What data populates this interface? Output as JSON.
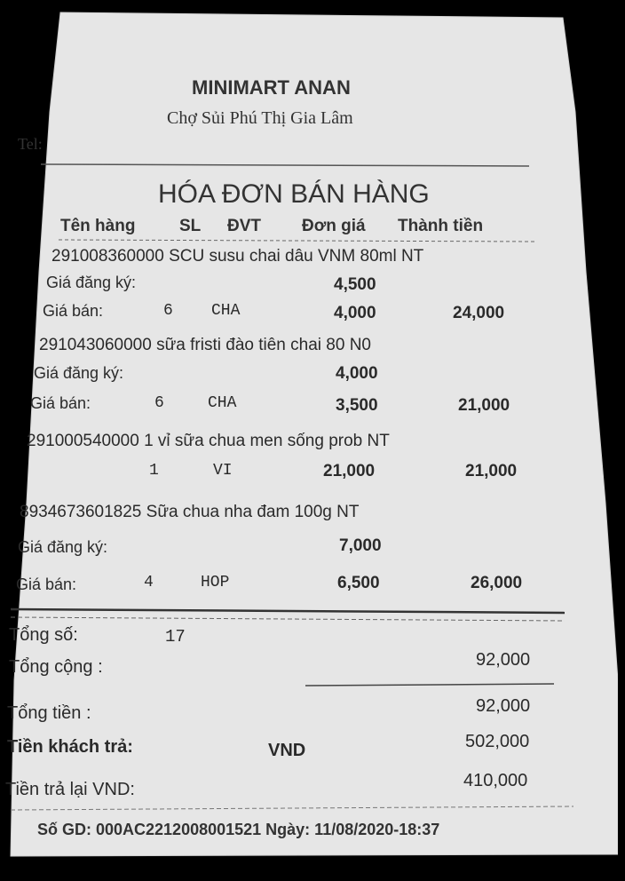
{
  "store": {
    "name": "MINIMART ANAN",
    "address": "Chợ Sủi Phú Thị Gia Lâm",
    "tel_label": "Tel:"
  },
  "receipt_title": "HÓA ĐƠN BÁN HÀNG",
  "columns": {
    "item": "Tên hàng",
    "qty": "SL",
    "unit": "ĐVT",
    "unit_price": "Đơn giá",
    "amount": "Thành tiền"
  },
  "labels": {
    "registered_price": "Giá đăng ký:",
    "sale_price": "Giá bán:"
  },
  "items": [
    {
      "name": "291008360000 SCU susu chai dâu VNM 80ml NT",
      "registered_price": "4,500",
      "qty": "6",
      "unit": "CHA",
      "unit_price": "4,000",
      "amount": "24,000"
    },
    {
      "name": "291043060000 sữa fristi đào tiên chai 80 N0",
      "registered_price": "4,000",
      "qty": "6",
      "unit": "CHA",
      "unit_price": "3,500",
      "amount": "21,000"
    },
    {
      "name": "291000540000 1 vỉ sữa chua men sống prob NT",
      "qty": "1",
      "unit": "VI",
      "unit_price": "21,000",
      "amount": "21,000"
    },
    {
      "name": "8934673601825 Sữa chua nha đam 100g NT",
      "registered_price": "7,000",
      "qty": "4",
      "unit": "HOP",
      "unit_price": "6,500",
      "amount": "26,000"
    }
  ],
  "totals": {
    "count_label": "Tổng số:",
    "count_value": "17",
    "subtotal_label": "Tổng cộng :",
    "subtotal_value": "92,000",
    "total_label": "Tổng tiền :",
    "total_value": "92,000",
    "paid_label": "Tiền khách trả:",
    "paid_currency": "VND",
    "paid_value": "502,000",
    "change_label": "Tiền trả lại VND:",
    "change_value": "410,000"
  },
  "footer": {
    "transaction": "Số GD: 000AC2212008001521 Ngày: 11/08/2020-18:37"
  }
}
